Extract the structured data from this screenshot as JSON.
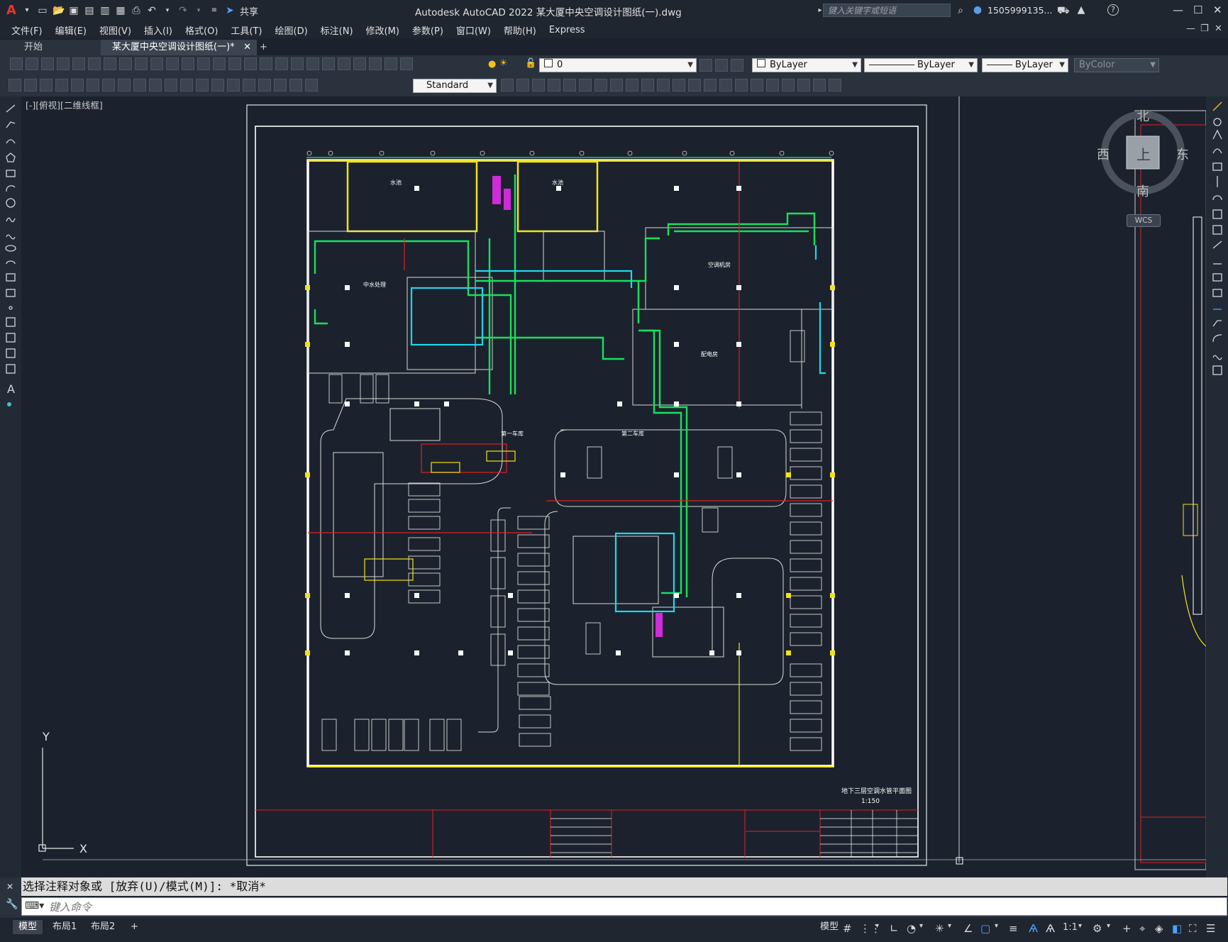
{
  "app": {
    "title": "Autodesk AutoCAD 2022    某大厦中央空调设计图纸(一).dwg",
    "share_label": "共享",
    "search_placeholder": "键入关键字或短语",
    "user_name": "1505999135...",
    "help": "?"
  },
  "menu": [
    "文件(F)",
    "编辑(E)",
    "视图(V)",
    "插入(I)",
    "格式(O)",
    "工具(T)",
    "绘图(D)",
    "标注(N)",
    "修改(M)",
    "参数(P)",
    "窗口(W)",
    "帮助(H)",
    "Express"
  ],
  "tabs": {
    "start": "开始",
    "active": "某大厦中央空调设计图纸(一)*",
    "add": "+"
  },
  "properties_bar": {
    "layer": "0",
    "color": "ByLayer",
    "linetype": "ByLayer",
    "lineweight": "ByLayer",
    "plotstyle": "ByColor",
    "text_style": "Standard"
  },
  "viewport_label": "[-][俯视][二维线框]",
  "viewcube": {
    "north": "北",
    "south": "南",
    "east": "东",
    "west": "西",
    "top": "上",
    "wcs": "WCS"
  },
  "ucs": {
    "x": "X",
    "y": "Y"
  },
  "drawing": {
    "rooms": [
      "水池",
      "水池",
      "中水处理",
      "空调机房",
      "配电房",
      "第一车库",
      "第二车库"
    ],
    "sheet_title": "地下三层空调水管平面图",
    "scale": "1:150"
  },
  "command": {
    "history": "选择注释对象或 [放弃(U)/模式(M)]: *取消*",
    "placeholder": "键入命令"
  },
  "layout_tabs": [
    "模型",
    "布局1",
    "布局2"
  ],
  "status": {
    "model": "模型",
    "scale": "1:1"
  }
}
